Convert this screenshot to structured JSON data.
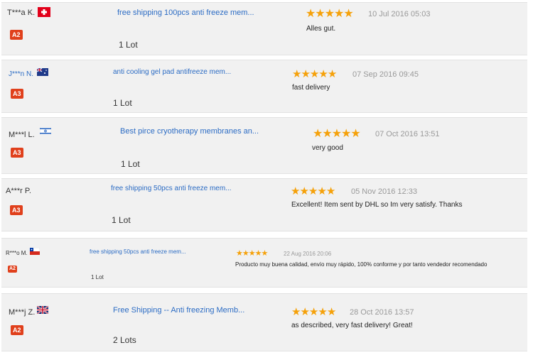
{
  "reviews": [
    {
      "name": "T***a K.",
      "level": "A2",
      "product": "free shipping 100pcs anti freeze mem...",
      "quantity": "1 Lot",
      "rating": 5,
      "date": "10 Jul 2016 05:03",
      "comment": "Alles gut."
    },
    {
      "name": "J***n N.",
      "level": "A3",
      "product": "anti cooling gel pad antifreeze mem...",
      "quantity": "1 Lot",
      "rating": 5,
      "date": "07 Sep 2016 09:45",
      "comment": "fast delivery"
    },
    {
      "name": "M***l L.",
      "level": "A3",
      "product": "Best pirce cryotherapy membranes an...",
      "quantity": "1 Lot",
      "rating": 5,
      "date": "07 Oct 2016 13:51",
      "comment": "very good"
    },
    {
      "name": "A***r P.",
      "level": "A3",
      "product": "free shipping 50pcs anti freeze mem...",
      "quantity": "1 Lot",
      "rating": 5,
      "date": "05 Nov 2016 12:33",
      "comment": "Excellent! Item sent by DHL so Im very satisfy. Thanks"
    },
    {
      "name": "R***o M.",
      "level": "A2",
      "product": "free shipping 50pcs anti freeze mem...",
      "quantity": "1 Lot",
      "rating": 5,
      "date": "22 Aug 2016 20:06",
      "comment": "Producto muy buena calidad, envío muy rápido, 100% conforme y por tanto vendedor recomendado"
    },
    {
      "name": "M***j Z.",
      "level": "A2",
      "product": "Free Shipping -- Anti freezing Memb...",
      "quantity": "2 Lots",
      "rating": 5,
      "date": "28 Oct 2016 13:57",
      "comment": "as described, very fast delivery! Great!"
    }
  ],
  "colors": {
    "accent": "#2c6cc4",
    "badge": "#e0401c",
    "star": "#f5a10a",
    "card_bg": "#f1f1f1"
  },
  "icons": {
    "star": "star-icon",
    "flags": [
      "switzerland-flag-icon",
      "australia-flag-icon",
      "israel-flag-icon",
      "",
      "chile-flag-icon",
      "uk-flag-icon"
    ]
  }
}
